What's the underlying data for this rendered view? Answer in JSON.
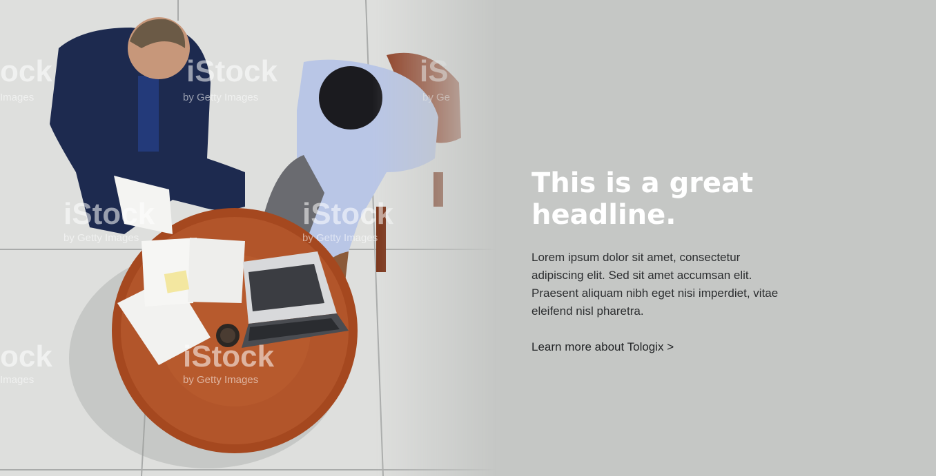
{
  "hero": {
    "headline": "This is a great headline.",
    "body": "Lorem ipsum dolor sit amet, consectetur adipiscing elit. Sed sit amet accumsan elit. Praesent aliquam nibh eget nisi imperdiet, vitae eleifend nisl pharetra.",
    "link_label": "Learn more about Tologix >",
    "background_color": "#c5c7c5",
    "headline_color": "#ffffff"
  },
  "image": {
    "alt_description": "two-businessmen-at-table-photo",
    "watermark_brand": "iStock",
    "watermark_tagline": "by Getty Images"
  }
}
